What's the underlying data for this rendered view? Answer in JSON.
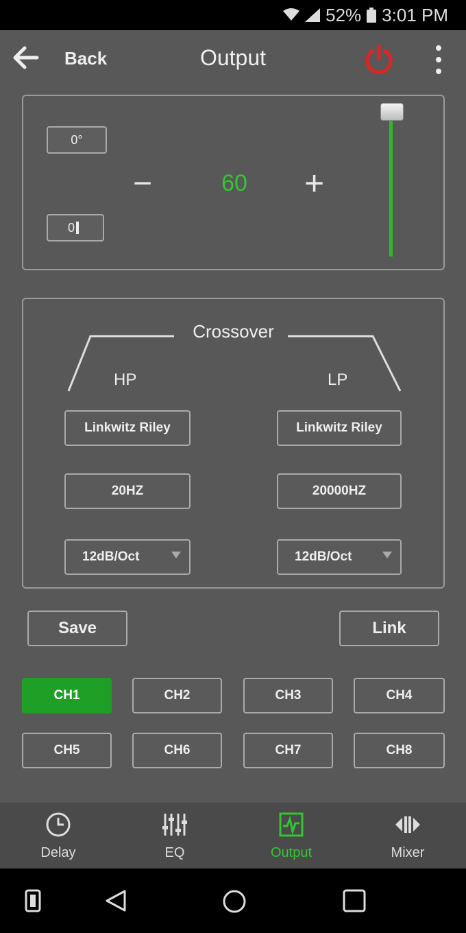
{
  "status": {
    "battery": "52%",
    "time": "3:01 PM"
  },
  "header": {
    "back_label": "Back",
    "title": "Output"
  },
  "gain": {
    "phase_value": "0°",
    "mute_value": "0",
    "minus": "−",
    "plus": "+",
    "value": "60",
    "volume_level_fraction": 0.97
  },
  "crossover": {
    "title": "Crossover",
    "hp": {
      "label": "HP",
      "filter": "Linkwitz Riley",
      "freq": "20HZ",
      "slope": "12dB/Oct"
    },
    "lp": {
      "label": "LP",
      "filter": "Linkwitz Riley",
      "freq": "20000HZ",
      "slope": "12dB/Oct"
    }
  },
  "actions": {
    "save": "Save",
    "link": "Link"
  },
  "channels": [
    "CH1",
    "CH2",
    "CH3",
    "CH4",
    "CH5",
    "CH6",
    "CH7",
    "CH8"
  ],
  "active_channel": "CH1",
  "tabs": [
    {
      "label": "Delay",
      "icon": "clock-icon"
    },
    {
      "label": "EQ",
      "icon": "equalizer-icon"
    },
    {
      "label": "Output",
      "icon": "output-icon"
    },
    {
      "label": "Mixer",
      "icon": "mixer-icon"
    }
  ],
  "active_tab": "Output",
  "colors": {
    "accent_green": "#33c633",
    "power_red": "#e02424",
    "background": "#585858"
  }
}
